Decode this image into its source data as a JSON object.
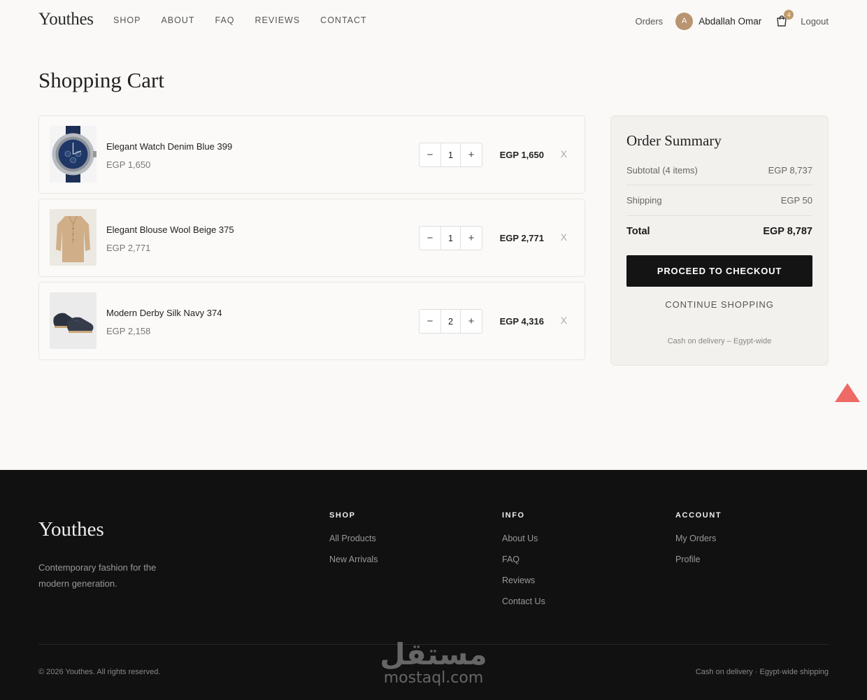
{
  "header": {
    "logo": "Youthes",
    "nav": [
      "SHOP",
      "ABOUT",
      "FAQ",
      "REVIEWS",
      "CONTACT"
    ],
    "orders": "Orders",
    "avatar_initial": "A",
    "user_name": "Abdallah Omar",
    "cart_count": "4",
    "logout": "Logout"
  },
  "page_title": "Shopping Cart",
  "cart": {
    "items": [
      {
        "name": "Elegant Watch Denim Blue 399",
        "price": "EGP 1,650",
        "qty": "1",
        "total": "EGP 1,650",
        "remove": "X",
        "image": "watch"
      },
      {
        "name": "Elegant Blouse Wool Beige 375",
        "price": "EGP 2,771",
        "qty": "1",
        "total": "EGP 2,771",
        "remove": "X",
        "image": "blouse"
      },
      {
        "name": "Modern Derby Silk Navy 374",
        "price": "EGP 2,158",
        "qty": "2",
        "total": "EGP 4,316",
        "remove": "X",
        "image": "shoes"
      }
    ],
    "minus": "−",
    "plus": "+"
  },
  "summary": {
    "title": "Order Summary",
    "subtotal_label": "Subtotal (4 items)",
    "subtotal_value": "EGP 8,737",
    "shipping_label": "Shipping",
    "shipping_value": "EGP 50",
    "total_label": "Total",
    "total_value": "EGP 8,787",
    "checkout": "PROCEED TO CHECKOUT",
    "continue": "CONTINUE SHOPPING",
    "note": "Cash on delivery – Egypt-wide"
  },
  "footer": {
    "logo": "Youthes",
    "tagline": "Contemporary fashion for the modern generation.",
    "shop": {
      "heading": "SHOP",
      "links": [
        "All Products",
        "New Arrivals"
      ]
    },
    "info": {
      "heading": "INFO",
      "links": [
        "About Us",
        "FAQ",
        "Reviews",
        "Contact Us"
      ]
    },
    "account": {
      "heading": "ACCOUNT",
      "links": [
        "My Orders",
        "Profile"
      ]
    },
    "copyright": "© 2026 Youthes. All rights reserved.",
    "shipping_note": "Cash on delivery · Egypt-wide shipping"
  },
  "watermark": {
    "arabic": "مستقل",
    "latin": "mostaql.com"
  },
  "colors": {
    "accent": "#c19a6b",
    "dark": "#141414",
    "scroll_top": "#ee6a66"
  }
}
